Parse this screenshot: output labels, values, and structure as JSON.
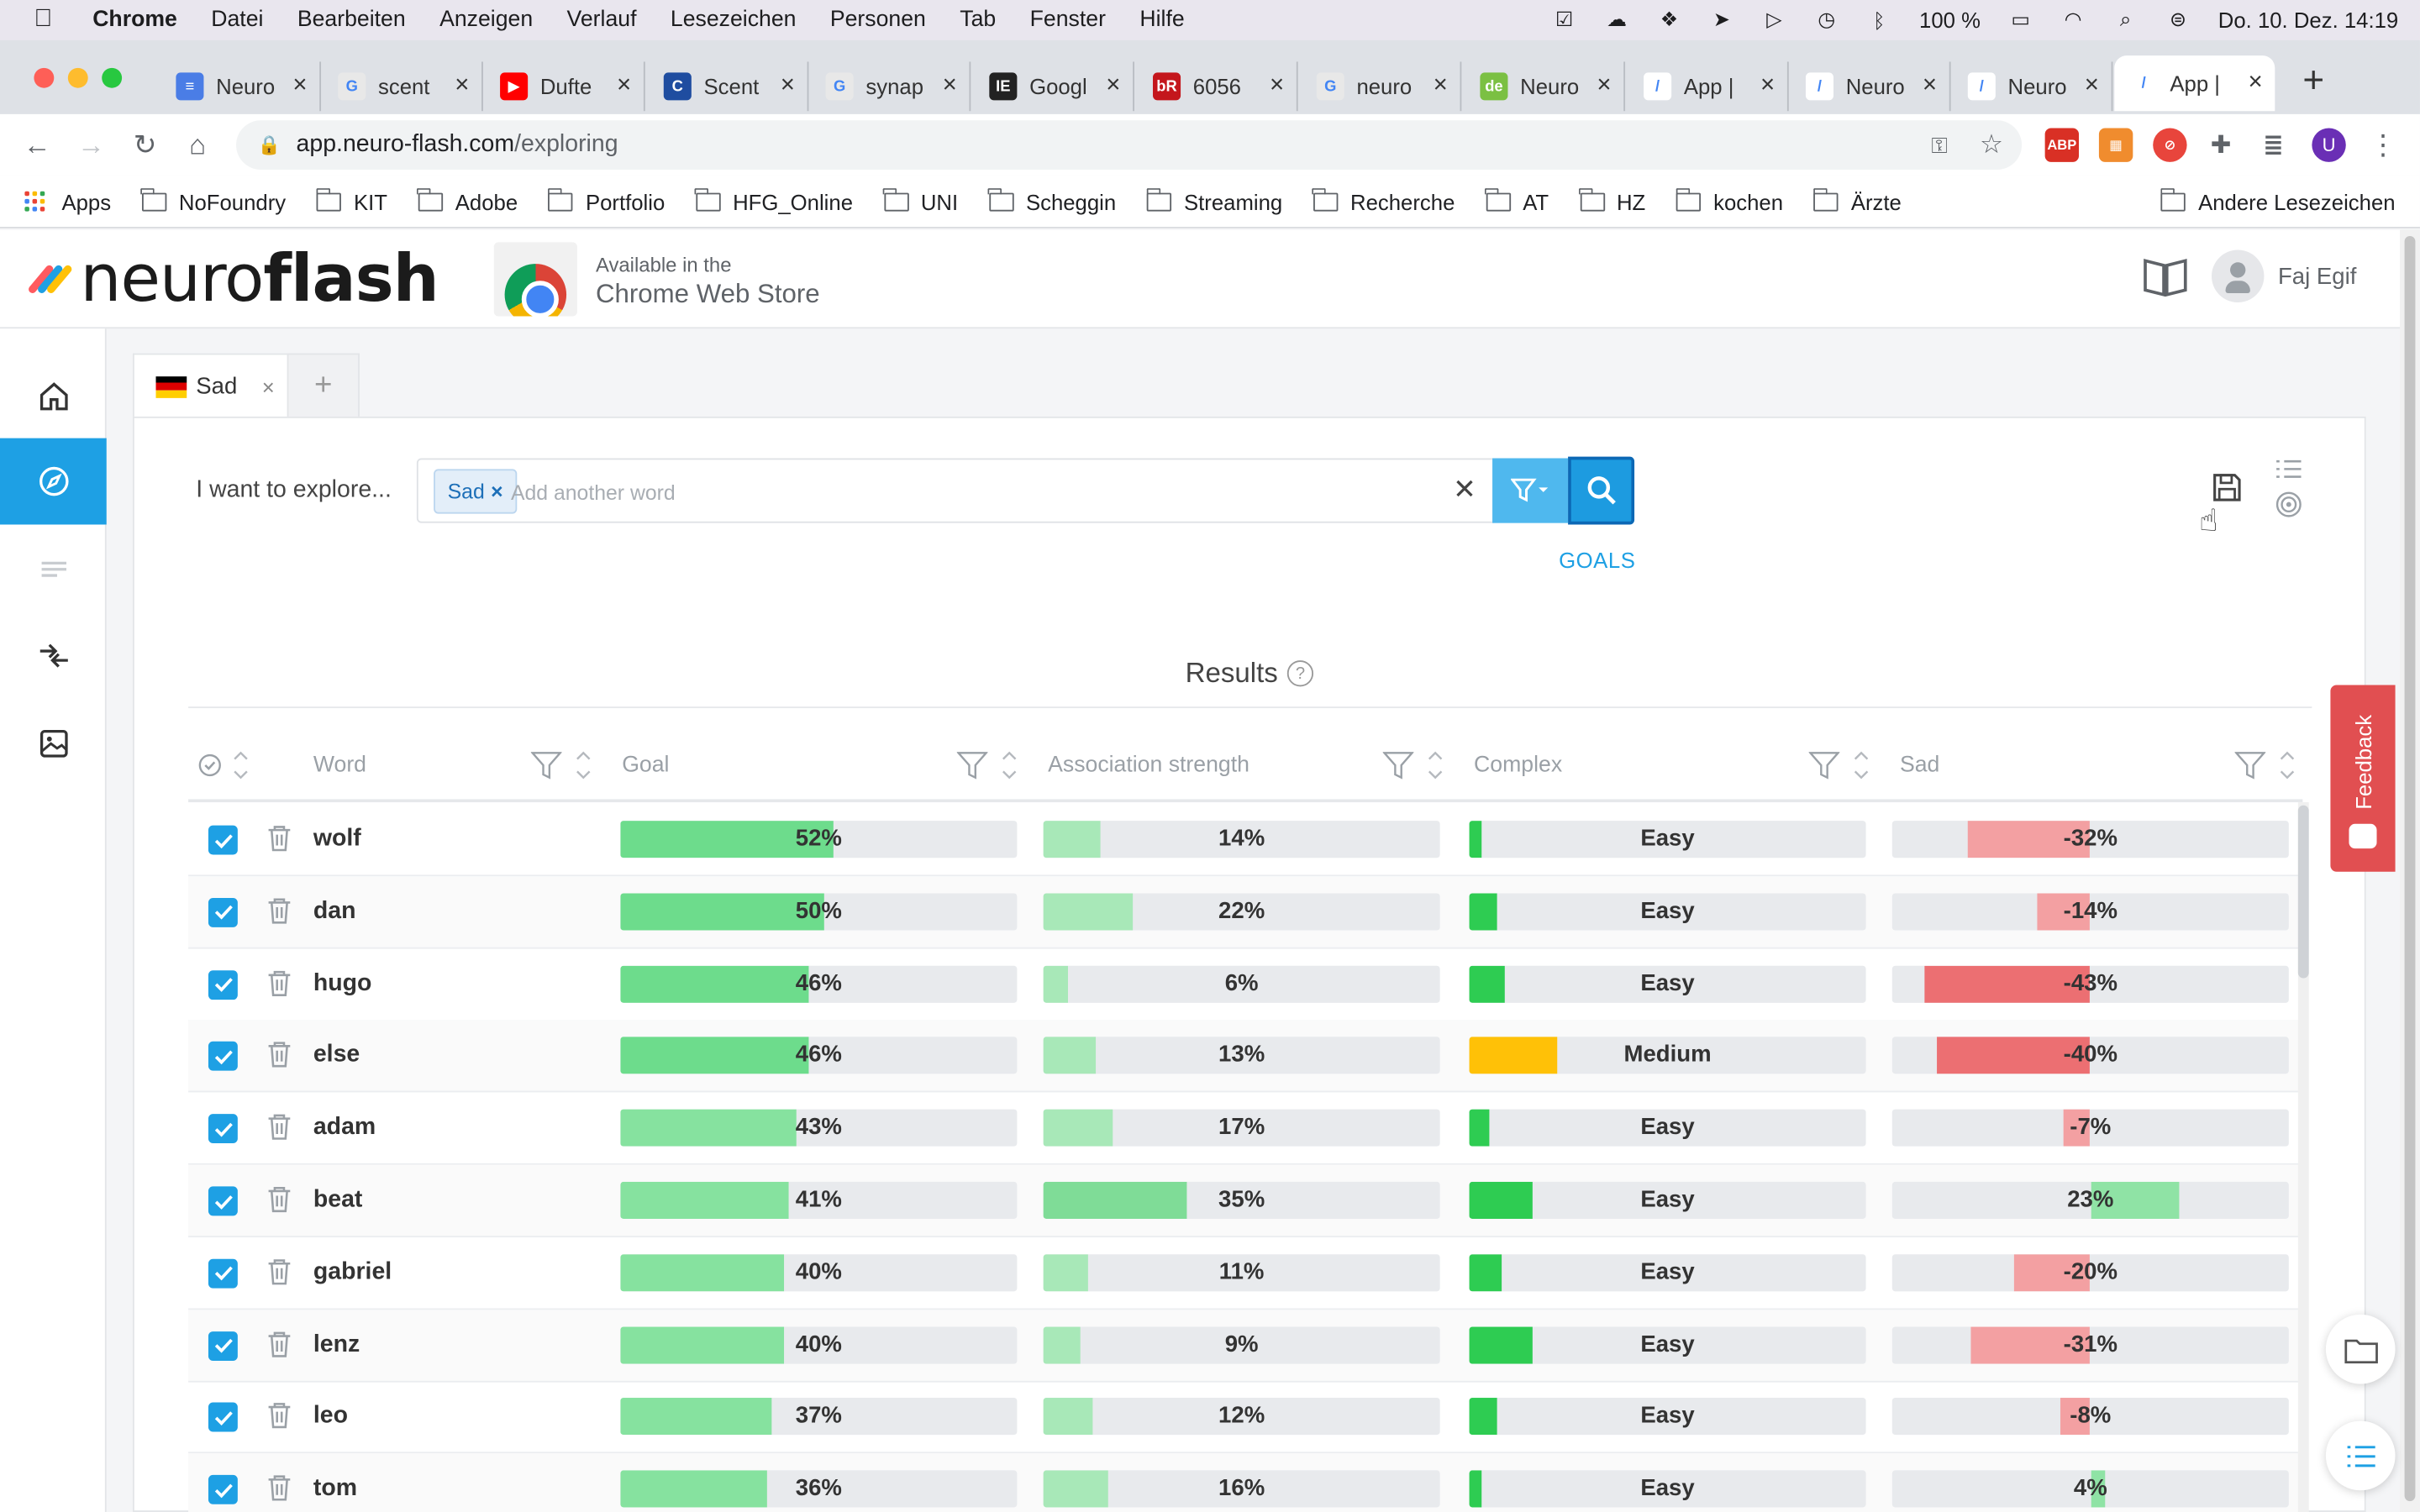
{
  "menubar": {
    "app": "Chrome",
    "items": [
      "Datei",
      "Bearbeiten",
      "Anzeigen",
      "Verlauf",
      "Lesezeichen",
      "Personen",
      "Tab",
      "Fenster",
      "Hilfe"
    ],
    "battery": "100 %",
    "datetime": "Do. 10. Dez.  14:19"
  },
  "tabs": [
    {
      "title": "Neuro",
      "color": "#4a7de6",
      "glyph": "≡"
    },
    {
      "title": "scent",
      "color": "#e8e8e8",
      "glyph": "G"
    },
    {
      "title": "Dufte",
      "color": "#ff0000",
      "glyph": "▶"
    },
    {
      "title": "Scent",
      "color": "#1f4da0",
      "glyph": "C"
    },
    {
      "title": "synap",
      "color": "#e8e8e8",
      "glyph": "G"
    },
    {
      "title": "Googl",
      "color": "#222222",
      "glyph": "IE"
    },
    {
      "title": "6056",
      "color": "#c4161c",
      "glyph": "bR"
    },
    {
      "title": "neuro",
      "color": "#e8e8e8",
      "glyph": "G"
    },
    {
      "title": "Neuro",
      "color": "#7bc043",
      "glyph": "de"
    },
    {
      "title": "App |",
      "color": "#ffffff",
      "glyph": "/"
    },
    {
      "title": "Neuro",
      "color": "#ffffff",
      "glyph": "/"
    },
    {
      "title": "Neuro",
      "color": "#ffffff",
      "glyph": "/"
    },
    {
      "title": "App |",
      "color": "#ffffff",
      "glyph": "/"
    }
  ],
  "address": {
    "host": "app.neuro-flash.com",
    "path": "/exploring"
  },
  "bookmarks": {
    "apps": "Apps",
    "folders": [
      "NoFoundry",
      "KIT",
      "Adobe",
      "Portfolio",
      "HFG_Online",
      "UNI",
      "Scheggin",
      "Streaming",
      "Recherche",
      "AT",
      "HZ",
      "kochen",
      "Ärzte"
    ],
    "other": "Andere Lesezeichen"
  },
  "header": {
    "logo_light": "neuro",
    "logo_bold": "flash",
    "store_line1": "Available in the",
    "store_line2": "Chrome Web Store",
    "user": "Faj Egif"
  },
  "workspace_tab": {
    "label": "Sad",
    "close": "×",
    "add": "+"
  },
  "search": {
    "label": "I want to explore...",
    "chip": "Sad",
    "chip_close": "×",
    "placeholder": "Add another word",
    "clear": "✕",
    "goals": "GOALS"
  },
  "results": {
    "title": "Results",
    "help": "?",
    "columns": [
      "Word",
      "Goal",
      "Association strength",
      "Complex",
      "Sad"
    ]
  },
  "rows": [
    {
      "word": "wolf",
      "goal": 52,
      "assoc": 14,
      "complex": "Easy",
      "complex_fill": 0.03,
      "sad": -32
    },
    {
      "word": "dan",
      "goal": 50,
      "assoc": 22,
      "complex": "Easy",
      "complex_fill": 0.07,
      "sad": -14
    },
    {
      "word": "hugo",
      "goal": 46,
      "assoc": 6,
      "complex": "Easy",
      "complex_fill": 0.09,
      "sad": -43
    },
    {
      "word": "else",
      "goal": 46,
      "assoc": 13,
      "complex": "Medium",
      "complex_fill": 0.22,
      "sad": -40
    },
    {
      "word": "adam",
      "goal": 43,
      "assoc": 17,
      "complex": "Easy",
      "complex_fill": 0.05,
      "sad": -7
    },
    {
      "word": "beat",
      "goal": 41,
      "assoc": 35,
      "complex": "Easy",
      "complex_fill": 0.16,
      "sad": 23
    },
    {
      "word": "gabriel",
      "goal": 40,
      "assoc": 11,
      "complex": "Easy",
      "complex_fill": 0.08,
      "sad": -20
    },
    {
      "word": "lenz",
      "goal": 40,
      "assoc": 9,
      "complex": "Easy",
      "complex_fill": 0.16,
      "sad": -31
    },
    {
      "word": "leo",
      "goal": 37,
      "assoc": 12,
      "complex": "Easy",
      "complex_fill": 0.07,
      "sad": -8
    },
    {
      "word": "tom",
      "goal": 36,
      "assoc": 16,
      "complex": "Easy",
      "complex_fill": 0.03,
      "sad": 4
    }
  ],
  "feedback": "Feedback",
  "colors": {
    "accent": "#1ea0e4",
    "goal_fill": "#6ddc8c",
    "assoc_fill": "#a8e8b8",
    "easy_fill": "#2ecc52",
    "medium_fill": "#ffc107",
    "sad_neg_light": "#f3a0a2",
    "sad_neg_strong": "#ec6f72",
    "sad_pos": "#8fe3a5"
  }
}
